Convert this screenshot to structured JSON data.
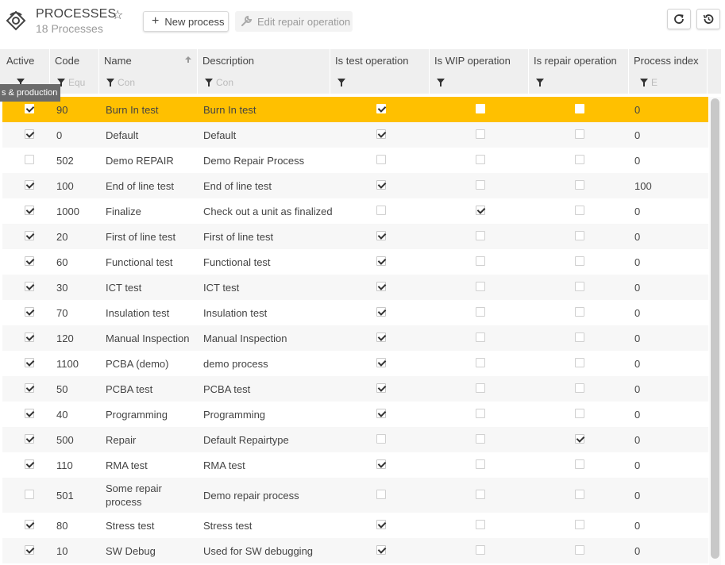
{
  "header": {
    "title": "PROCESSES",
    "subtitle": "18 Processes",
    "new_button_label": "New process",
    "edit_button_label": "Edit repair operation"
  },
  "tooltip": "s & production",
  "columns": [
    {
      "key": "active",
      "label": "Active"
    },
    {
      "key": "code",
      "label": "Code"
    },
    {
      "key": "name",
      "label": "Name"
    },
    {
      "key": "description",
      "label": "Description"
    },
    {
      "key": "is_test",
      "label": "Is test operation"
    },
    {
      "key": "is_wip",
      "label": "Is WIP operation"
    },
    {
      "key": "is_repair",
      "label": "Is repair operation"
    },
    {
      "key": "process_index",
      "label": "Process index"
    }
  ],
  "filters": {
    "code_placeholder": "Equ",
    "name_placeholder": "Con",
    "description_placeholder": "Con",
    "process_index_placeholder": "E"
  },
  "selected_row": 0,
  "rows": [
    {
      "active": true,
      "code": "90",
      "name": "Burn In test",
      "description": "Burn In test",
      "is_test": true,
      "is_wip": false,
      "is_repair": false,
      "process_index": "0"
    },
    {
      "active": true,
      "code": "0",
      "name": "Default",
      "description": "Default",
      "is_test": true,
      "is_wip": false,
      "is_repair": false,
      "process_index": "0"
    },
    {
      "active": false,
      "code": "502",
      "name": "Demo REPAIR",
      "description": "Demo Repair Process",
      "is_test": false,
      "is_wip": false,
      "is_repair": false,
      "process_index": "0"
    },
    {
      "active": true,
      "code": "100",
      "name": "End of line test",
      "description": "End of line test",
      "is_test": true,
      "is_wip": false,
      "is_repair": false,
      "process_index": "100"
    },
    {
      "active": true,
      "code": "1000",
      "name": "Finalize",
      "description": "Check out a unit as finalized",
      "is_test": false,
      "is_wip": true,
      "is_repair": false,
      "process_index": "0"
    },
    {
      "active": true,
      "code": "20",
      "name": "First of line test",
      "description": "First of line test",
      "is_test": true,
      "is_wip": false,
      "is_repair": false,
      "process_index": "0"
    },
    {
      "active": true,
      "code": "60",
      "name": "Functional test",
      "description": "Functional test",
      "is_test": true,
      "is_wip": false,
      "is_repair": false,
      "process_index": "0"
    },
    {
      "active": true,
      "code": "30",
      "name": "ICT test",
      "description": "ICT test",
      "is_test": true,
      "is_wip": false,
      "is_repair": false,
      "process_index": "0"
    },
    {
      "active": true,
      "code": "70",
      "name": "Insulation test",
      "description": "Insulation test",
      "is_test": true,
      "is_wip": false,
      "is_repair": false,
      "process_index": "0"
    },
    {
      "active": true,
      "code": "120",
      "name": "Manual Inspection",
      "description": "Manual Inspection",
      "is_test": true,
      "is_wip": false,
      "is_repair": false,
      "process_index": "0"
    },
    {
      "active": true,
      "code": "1100",
      "name": "PCBA (demo)",
      "description": "demo process",
      "is_test": true,
      "is_wip": false,
      "is_repair": false,
      "process_index": "0"
    },
    {
      "active": true,
      "code": "50",
      "name": "PCBA test",
      "description": "PCBA test",
      "is_test": true,
      "is_wip": false,
      "is_repair": false,
      "process_index": "0"
    },
    {
      "active": true,
      "code": "40",
      "name": "Programming",
      "description": "Programming",
      "is_test": true,
      "is_wip": false,
      "is_repair": false,
      "process_index": "0"
    },
    {
      "active": true,
      "code": "500",
      "name": "Repair",
      "description": "Default Repairtype",
      "is_test": false,
      "is_wip": false,
      "is_repair": true,
      "process_index": "0"
    },
    {
      "active": true,
      "code": "110",
      "name": "RMA test",
      "description": "RMA test",
      "is_test": true,
      "is_wip": false,
      "is_repair": false,
      "process_index": "0"
    },
    {
      "active": false,
      "code": "501",
      "name": "Some repair process",
      "description": "Demo repair process",
      "is_test": false,
      "is_wip": false,
      "is_repair": false,
      "process_index": "0"
    },
    {
      "active": true,
      "code": "80",
      "name": "Stress test",
      "description": "Stress test",
      "is_test": true,
      "is_wip": false,
      "is_repair": false,
      "process_index": "0"
    },
    {
      "active": true,
      "code": "10",
      "name": "SW Debug",
      "description": "Used for SW debugging",
      "is_test": true,
      "is_wip": false,
      "is_repair": false,
      "process_index": "0"
    }
  ]
}
